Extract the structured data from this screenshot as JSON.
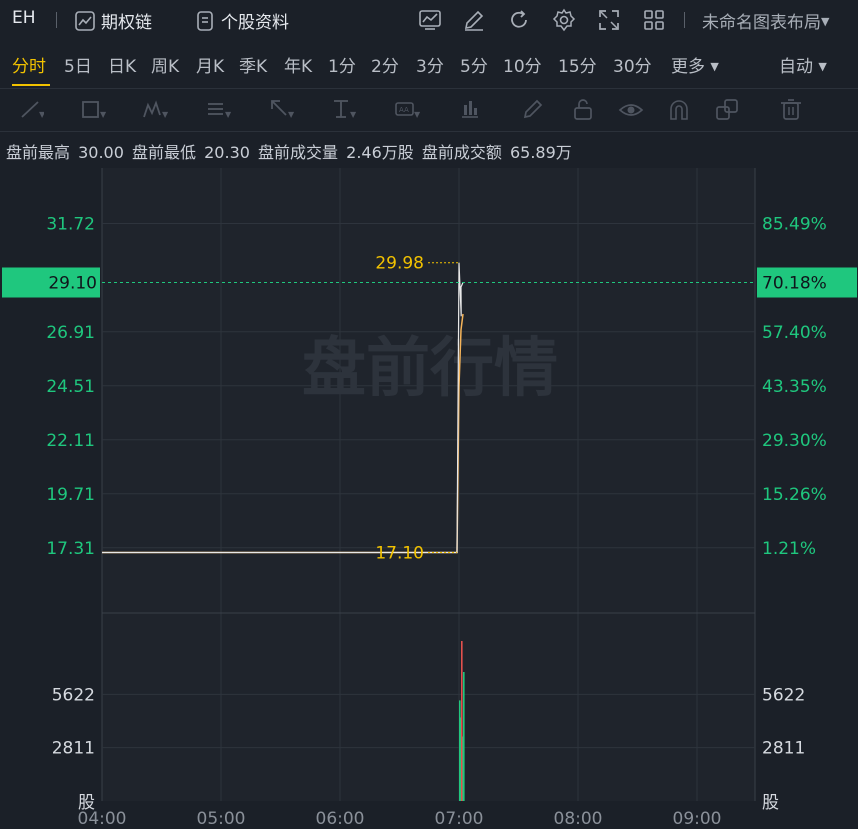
{
  "topbar": {
    "symbol": "EH",
    "options_chain": "期权链",
    "stock_profile": "个股资料",
    "layout_name": "未命名图表布局",
    "icons": [
      "chart-icon",
      "edit-icon",
      "refresh-icon",
      "settings-icon",
      "fullscreen-icon",
      "grid-icon"
    ]
  },
  "periods": [
    "分时",
    "5日",
    "日K",
    "周K",
    "月K",
    "季K",
    "年K",
    "1分",
    "2分",
    "3分",
    "5分",
    "10分",
    "15分",
    "30分",
    "更多"
  ],
  "active_period": "分时",
  "auto_label": "自动",
  "drawing_tools": [
    "line-tool-icon",
    "rectangle-tool-icon",
    "wave-tool-icon",
    "text-tool-icon",
    "arrow-tool-icon",
    "measure-tool-icon",
    "label-tool-icon",
    "bar-tool-icon",
    "brush-icon",
    "lock-icon",
    "eye-icon",
    "magnet-icon",
    "layers-icon",
    "trash-icon"
  ],
  "info": {
    "high_label": "盘前最高",
    "high_value": "30.00",
    "low_label": "盘前最低",
    "low_value": "20.30",
    "volume_label": "盘前成交量",
    "volume_value": "2.46万股",
    "amount_label": "盘前成交额",
    "amount_value": "65.89万"
  },
  "watermark": "盘前行情",
  "colors": {
    "up": "#1fc77e",
    "down": "#e2514d",
    "price_line": "#f5b45a",
    "accent": "#f2c200",
    "text_green": "#1fc77e"
  },
  "chart_data": {
    "type": "line",
    "x_ticks": [
      "04:00",
      "05:00",
      "06:00",
      "07:00",
      "08:00",
      "09:00"
    ],
    "price_ticks": [
      "31.72",
      "26.91",
      "24.51",
      "22.11",
      "19.71",
      "17.31"
    ],
    "pct_ticks": [
      "85.49%",
      "57.40%",
      "43.35%",
      "29.30%",
      "15.26%",
      "1.21%"
    ],
    "current_price": "29.10",
    "current_pct": "70.18%",
    "ylim": [
      14.9,
      34.1
    ],
    "high_label": "29.98",
    "low_label": "17.10",
    "price": [
      {
        "t": "04:00",
        "p": 17.1
      },
      {
        "t": "06:59",
        "p": 17.1
      },
      {
        "t": "07:00",
        "p": 29.98
      },
      {
        "t": "07:00",
        "p": 27.6
      },
      {
        "t": "07:01",
        "p": 28.9
      },
      {
        "t": "07:02",
        "p": 29.1
      }
    ],
    "avg_price": [
      {
        "t": "04:00",
        "p": 17.1
      },
      {
        "t": "06:59",
        "p": 17.1
      },
      {
        "t": "07:00",
        "p": 24.5
      },
      {
        "t": "07:01",
        "p": 27.0
      },
      {
        "t": "07:02",
        "p": 27.7
      }
    ],
    "volume_ticks": [
      "5622",
      "2811"
    ],
    "volume_unit": "股",
    "volume_ylim": [
      0,
      8433
    ],
    "volume": [
      {
        "t": "07:00",
        "v": 5300,
        "dir": "up"
      },
      {
        "t": "07:00",
        "v": 4400,
        "dir": "up"
      },
      {
        "t": "07:01",
        "v": 8433,
        "dir": "down"
      },
      {
        "t": "07:01",
        "v": 3400,
        "dir": "up"
      },
      {
        "t": "07:02",
        "v": 6800,
        "dir": "up"
      }
    ]
  }
}
